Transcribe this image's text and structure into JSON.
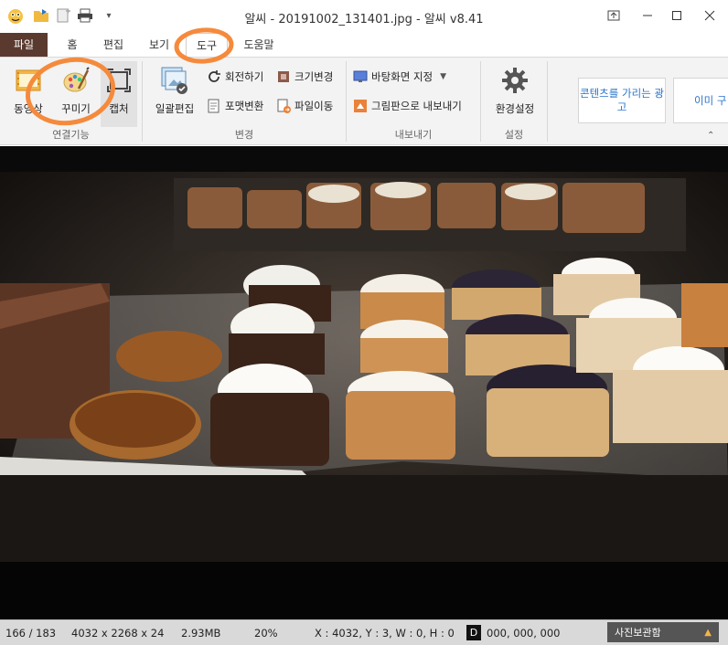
{
  "window": {
    "title": "알씨 - 20191002_131401.jpg - 알씨 v8.41"
  },
  "menu_tabs": [
    {
      "label": "파일"
    },
    {
      "label": "홈"
    },
    {
      "label": "편집"
    },
    {
      "label": "보기"
    },
    {
      "label": "도구"
    },
    {
      "label": "도움말"
    }
  ],
  "ribbon": {
    "group1": {
      "buttons": [
        "동영상",
        "꾸미기",
        "캡처"
      ],
      "label": "연결기능"
    },
    "group2": {
      "big_button": "일괄편집",
      "small_buttons": [
        "회전하기",
        "크기변경",
        "포맷변환",
        "파일이동"
      ],
      "label": "변경"
    },
    "group3": {
      "small_buttons": [
        "바탕화면 지정",
        "그림판으로 내보내기"
      ],
      "label": "내보내기"
    },
    "group4": {
      "big_button": "환경설정",
      "label": "설정"
    },
    "ads": [
      "콘텐츠를 가리는 광고",
      "이미 구"
    ]
  },
  "status": {
    "index": "166 / 183",
    "dimensions": "4032 x 2268 x 24",
    "size": "2.93MB",
    "zoom": "20%",
    "coords": "X : 4032, Y : 3, W : 0, H : 0",
    "d_label": "D",
    "color": "000, 000, 000",
    "panel_button": "사진보관함"
  },
  "colors": {
    "file_tab": "#5a3a2f",
    "annotation": "#f58a3c",
    "status_bar": "#d9d9d9"
  }
}
